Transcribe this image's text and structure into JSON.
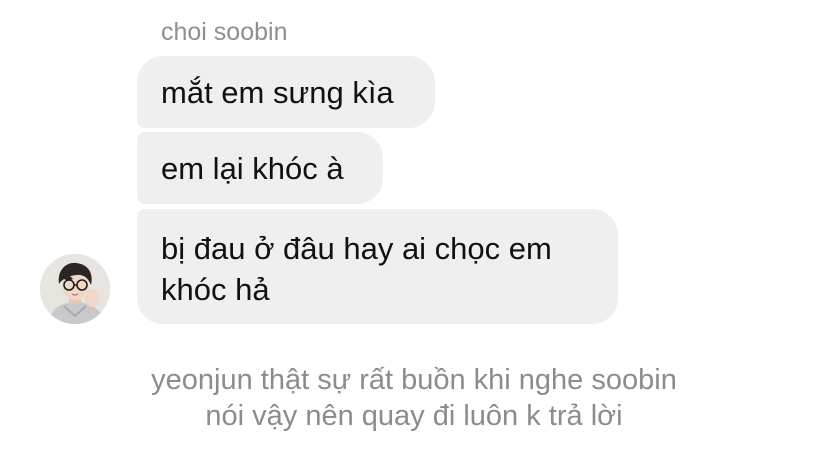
{
  "chat": {
    "sender_name": "choi soobin",
    "messages": [
      {
        "lines": [
          "mắt em sưng kìa"
        ]
      },
      {
        "lines": [
          "em lại khóc à"
        ]
      },
      {
        "lines": [
          "bị đau ở đâu hay ai chọc em",
          "khóc hả"
        ]
      }
    ]
  },
  "caption": {
    "lines": [
      "yeonjun thật sự rất buồn khi nghe soobin",
      "nói vậy nên quay đi luôn k trả lời"
    ]
  },
  "colors": {
    "bubble_bg": "#efefef",
    "message_text": "#111111",
    "muted_text": "#8e8e93"
  },
  "icons": {
    "avatar": "avatar-photo"
  }
}
